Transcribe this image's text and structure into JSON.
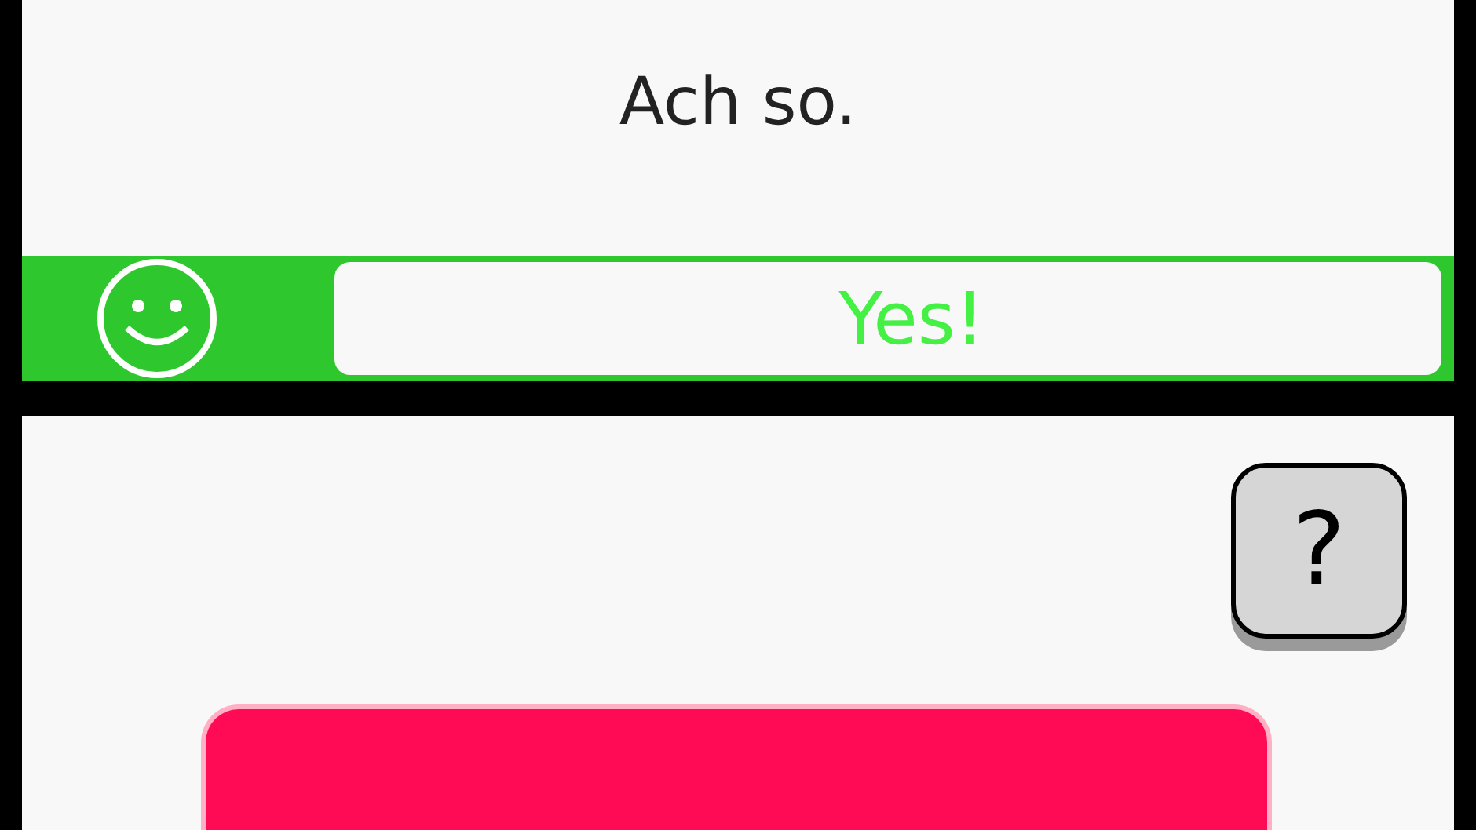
{
  "prompt": "Ach so.",
  "feedback": {
    "correct": true,
    "label": "Yes!"
  },
  "help_button": "?"
}
